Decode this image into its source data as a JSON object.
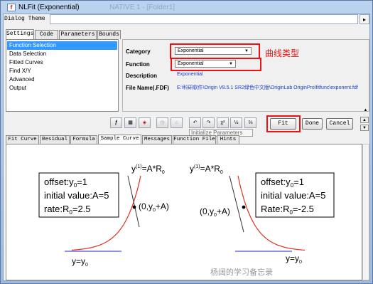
{
  "window": {
    "title": "NLFit (Exponential)",
    "ghost_title": "NATIVE 1 - [Folder1]",
    "icon_glyph": "f"
  },
  "dialog_theme": {
    "label": "Dialog Theme",
    "arrow": "▸"
  },
  "top_tabs": [
    "Settings",
    "Code",
    "Parameters",
    "Bounds"
  ],
  "settings_list": [
    "Function Selection",
    "Data Selection",
    "Fitted Curves",
    "Find X/Y",
    "Advanced",
    "Output"
  ],
  "fields": {
    "category_label": "Category",
    "category_value": "Exponential",
    "function_label": "Function",
    "function_value": "Exponential",
    "description_label": "Description",
    "description_value": "Exponential",
    "filename_label": "File Name(.FDF)",
    "filename_value": "E:\\科研软件\\Origin V8.5.1 SR2绿色中文版\\OriginLab OriginPro\\fitfunc\\exponent.fdf"
  },
  "annotation": "曲线类型",
  "toolbar_icons": [
    "fx-icon",
    "chart-icon",
    "param-icon",
    "clock-icon",
    "bracket-icon",
    "undo-icon",
    "redo-icon",
    "chi-square-icon",
    "iterate-one-icon",
    "iterate-all-icon"
  ],
  "tooltip": "Initialize Parameters",
  "buttons": {
    "fit": "Fit",
    "done": "Done",
    "cancel": "Cancel"
  },
  "bottom_tabs": [
    "Fit Curve",
    "Residual",
    "Formula",
    "Sample Curve",
    "Messages",
    "Function File",
    "Hints"
  ],
  "sample": {
    "left_box": {
      "l1": "offset:y",
      "l1s": "0",
      "l1e": "=1",
      "l2": "initial value:A=5",
      "l3": "rate:R",
      "l3s": "0",
      "l3e": "=2.5"
    },
    "right_box": {
      "l1": "offset:y",
      "l1s": "0",
      "l1e": "=1",
      "l2": "initial value:A=5",
      "l3": "Rate:R",
      "l3s": "0",
      "l3e": "=-2.5"
    },
    "deriv_label": {
      "y": "y",
      "sup": "(1)",
      "rest": "=A*R",
      "sub": "0"
    },
    "point_label": {
      "a": "(0,y",
      "sub": "0",
      "b": "+A)"
    },
    "baseline_label": {
      "a": "y=y",
      "sub": "0"
    }
  },
  "watermark": "杨阔的学习备忘录",
  "colors": {
    "red_outline": "#e11111",
    "curve": "#e03020",
    "baseline": "#2020d0",
    "selection": "#3399ff"
  }
}
